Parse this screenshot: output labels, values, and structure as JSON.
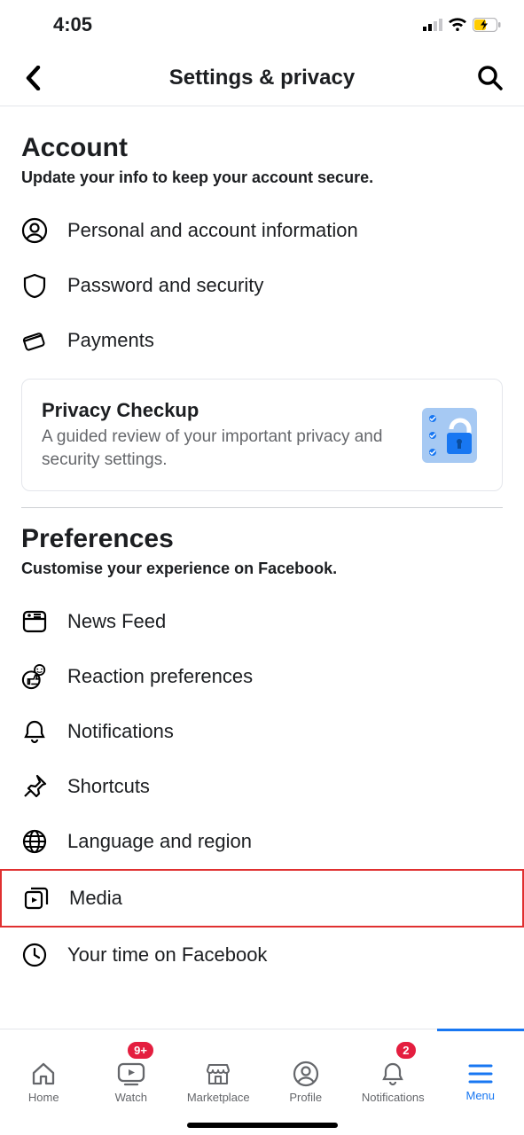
{
  "status": {
    "time": "4:05"
  },
  "header": {
    "title": "Settings & privacy"
  },
  "account": {
    "title": "Account",
    "subtitle": "Update your info to keep your account secure.",
    "items": [
      {
        "label": "Personal and account information"
      },
      {
        "label": "Password and security"
      },
      {
        "label": "Payments"
      }
    ],
    "privacy": {
      "title": "Privacy Checkup",
      "subtitle": "A guided review of your important privacy and security settings."
    }
  },
  "preferences": {
    "title": "Preferences",
    "subtitle": "Customise your experience on Facebook.",
    "items": [
      {
        "label": "News Feed"
      },
      {
        "label": "Reaction preferences"
      },
      {
        "label": "Notifications"
      },
      {
        "label": "Shortcuts"
      },
      {
        "label": "Language and region"
      },
      {
        "label": "Media"
      },
      {
        "label": "Your time on Facebook"
      }
    ]
  },
  "nav": {
    "home": "Home",
    "watch": "Watch",
    "watch_badge": "9+",
    "marketplace": "Marketplace",
    "profile": "Profile",
    "notifications": "Notifications",
    "notifications_badge": "2",
    "menu": "Menu"
  }
}
